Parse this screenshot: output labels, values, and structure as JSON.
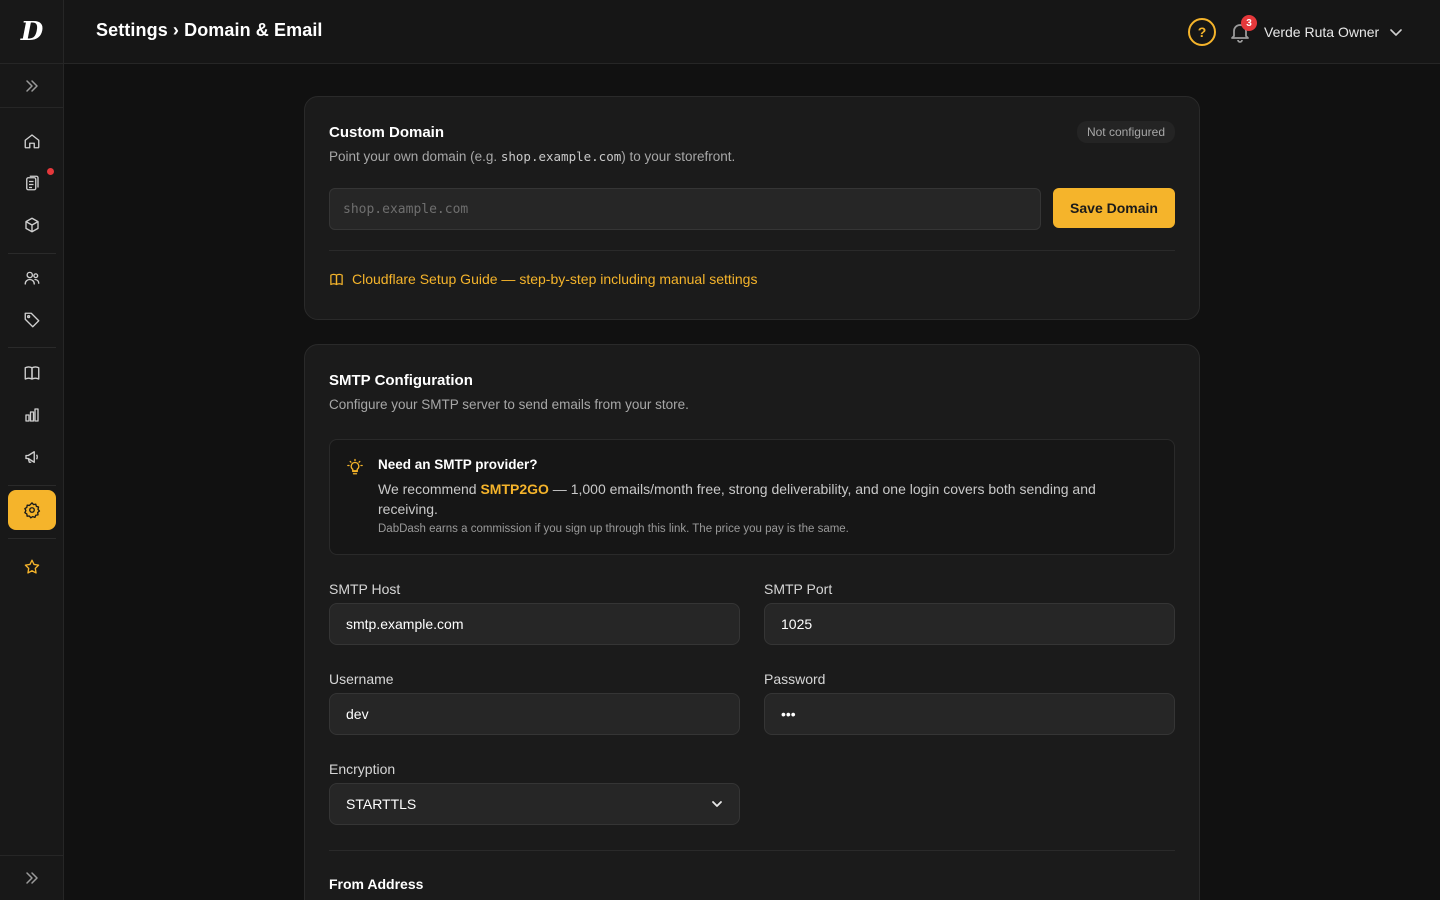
{
  "app": {
    "logo_letter": "D"
  },
  "header": {
    "title": "Settings › Domain & Email",
    "help_icon": "?",
    "notification_count": "3",
    "user_name": "Verde Ruta Owner"
  },
  "sidebar": {
    "items": [
      {
        "name": "home-icon"
      },
      {
        "name": "orders-icon",
        "has_dot": true
      },
      {
        "name": "products-box-icon"
      },
      {
        "name": "customers-icon"
      },
      {
        "name": "tag-icon"
      },
      {
        "name": "book-icon"
      },
      {
        "name": "analytics-chart-icon"
      },
      {
        "name": "megaphone-icon"
      },
      {
        "name": "gear-icon",
        "active": true
      },
      {
        "name": "star-icon"
      }
    ]
  },
  "domain": {
    "title": "Custom Domain",
    "subtitle_prefix": "Point your own domain (e.g. ",
    "subtitle_example": "shop.example.com",
    "subtitle_suffix": ") to your storefront.",
    "status": "Not configured",
    "input_placeholder": "shop.example.com",
    "save_label": "Save Domain",
    "guide_link": "Cloudflare Setup Guide — step-by-step including manual settings"
  },
  "smtp": {
    "title": "SMTP Configuration",
    "subtitle": "Configure your SMTP server to send emails from your store.",
    "callout": {
      "title": "Need an SMTP provider?",
      "body_prefix": "We recommend ",
      "brand": "SMTP2GO",
      "body_suffix": " — 1,000 emails/month free, strong deliverability, and one login covers both sending and receiving.",
      "note": "DabDash earns a commission if you sign up through this link. The price you pay is the same."
    },
    "host_label": "SMTP Host",
    "host_value": "smtp.example.com",
    "port_label": "SMTP Port",
    "port_value": "1025",
    "username_label": "Username",
    "username_value": "dev",
    "password_label": "Password",
    "password_value": "•••",
    "encryption_label": "Encryption",
    "encryption_value": "STARTTLS",
    "from_title": "From Address"
  },
  "colors": {
    "accent": "#f5b42b",
    "background": "#111111",
    "card": "#1b1b1b",
    "badge_red": "#e5383b"
  }
}
